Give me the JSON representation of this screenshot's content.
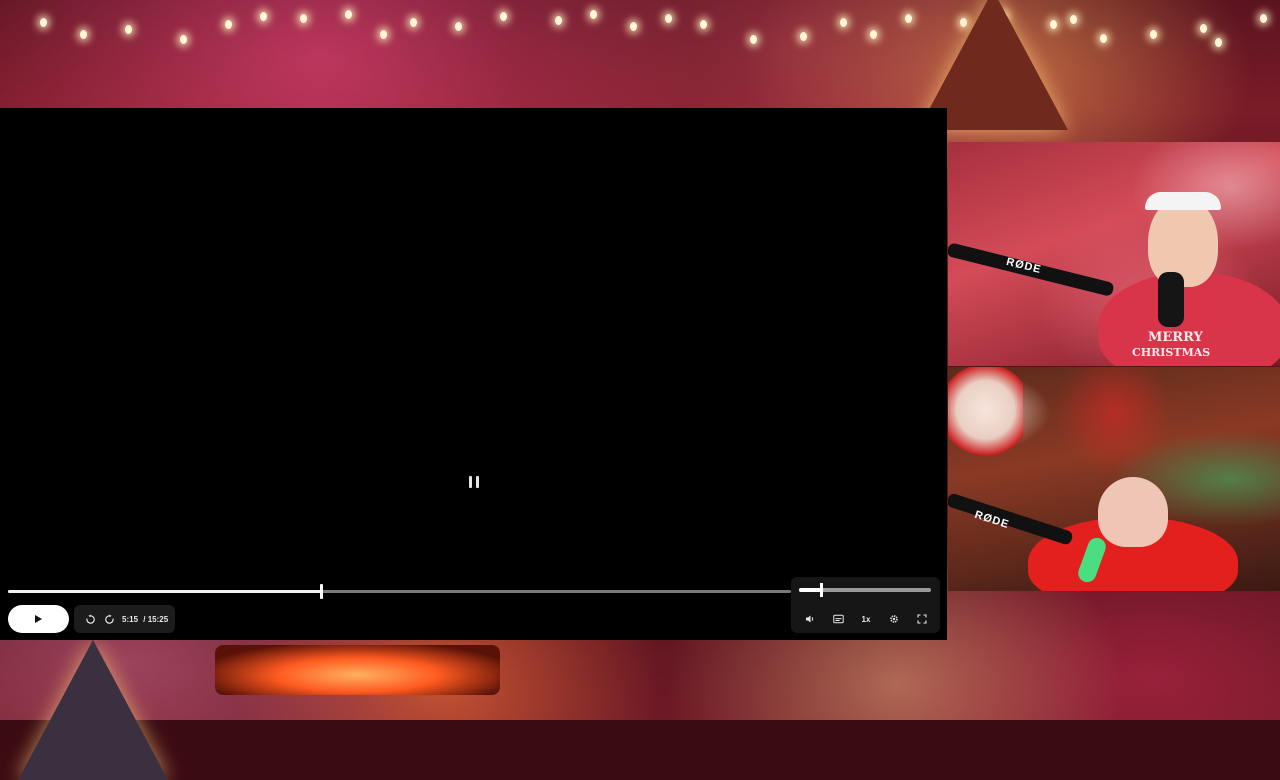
{
  "player": {
    "state": "paused",
    "current_time": "5:15",
    "separator": "/",
    "duration": "15:25",
    "progress_fraction": 0.4,
    "volume_fraction": 0.17,
    "speed_label": "1x"
  },
  "controls": {
    "play_icon": "play-icon",
    "rewind_icon": "replay-10-icon",
    "forward_icon": "forward-10-icon",
    "volume_icon": "volume-icon",
    "captions_icon": "captions-icon",
    "settings_icon": "gear-icon",
    "fullscreen_icon": "fullscreen-icon"
  },
  "webcams": {
    "cam1_mic_brand": "RØDE",
    "cam1_sweater_text": "MERRY",
    "cam1_sweater_text2": "CHRISTMAS",
    "cam2_mic_brand": "RØDE"
  },
  "colors": {
    "player_bg": "#000000",
    "accent": "#ffffff"
  }
}
